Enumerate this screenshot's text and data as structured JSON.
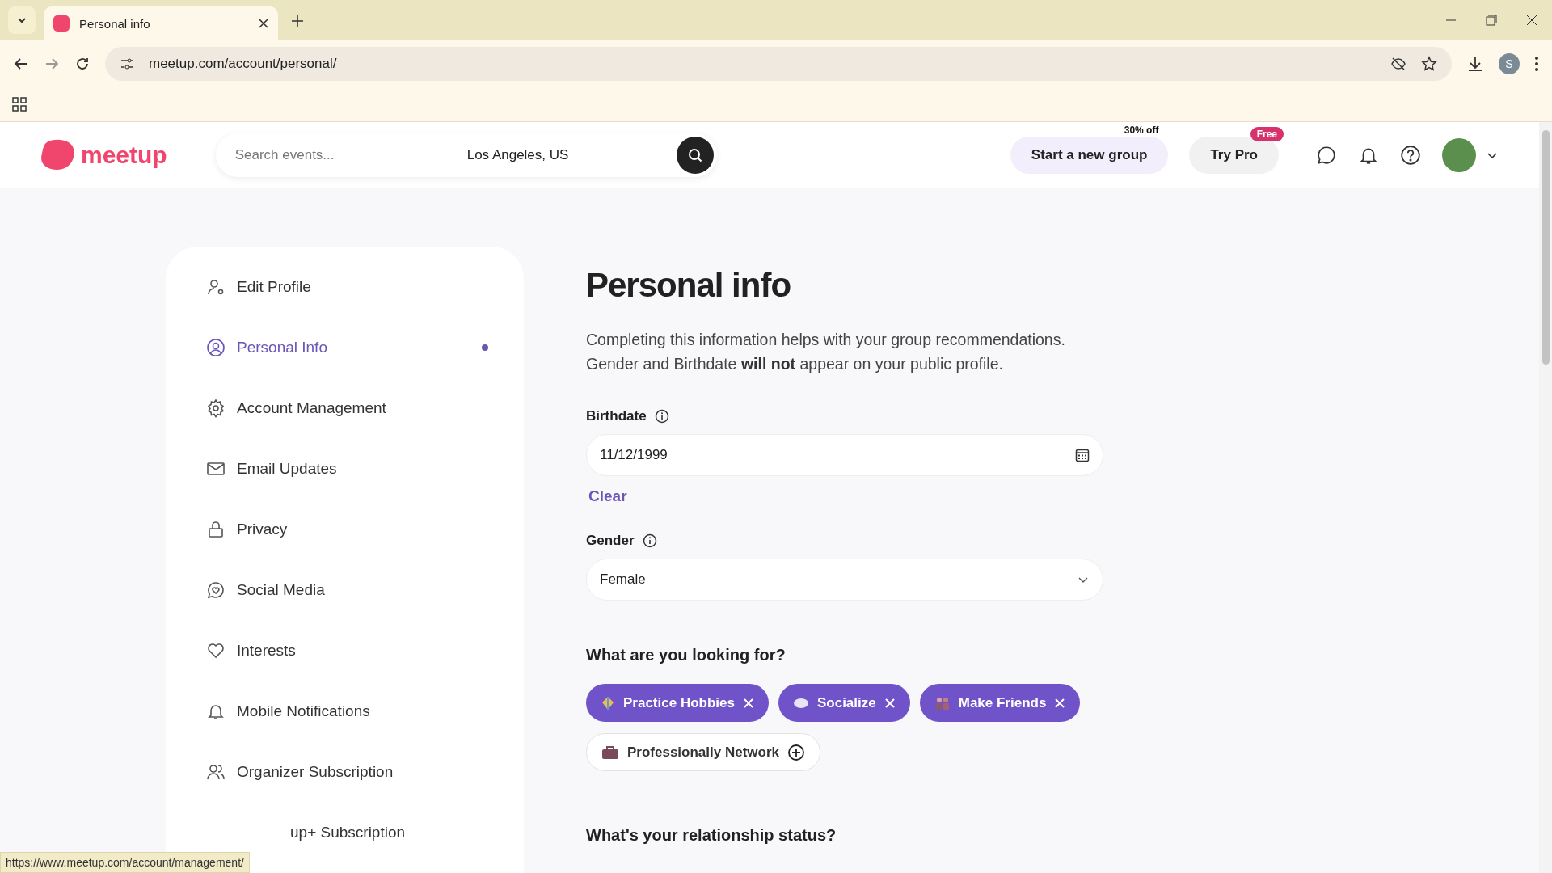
{
  "browser": {
    "tab_title": "Personal info",
    "url": "meetup.com/account/personal/",
    "profile_letter": "S",
    "status_url": "https://www.meetup.com/account/management/"
  },
  "header": {
    "logo": "meetup",
    "search_placeholder": "Search events...",
    "location": "Los Angeles, US",
    "start_group": "Start a new group",
    "start_group_badge": "30% off",
    "try_pro": "Try Pro",
    "try_pro_badge": "Free"
  },
  "sidebar": {
    "items": [
      {
        "label": "Edit Profile",
        "selected": false
      },
      {
        "label": "Personal Info",
        "selected": true
      },
      {
        "label": "Account Management",
        "selected": false
      },
      {
        "label": "Email Updates",
        "selected": false
      },
      {
        "label": "Privacy",
        "selected": false
      },
      {
        "label": "Social Media",
        "selected": false
      },
      {
        "label": "Interests",
        "selected": false
      },
      {
        "label": "Mobile Notifications",
        "selected": false
      },
      {
        "label": "Organizer Subscription",
        "selected": false
      },
      {
        "label": "up+ Subscription",
        "selected": false
      }
    ]
  },
  "main": {
    "title": "Personal info",
    "intro": "Completing this information helps with your group recommendations. Gender and Birthdate **will not** appear on your public profile.",
    "birthdate": {
      "label": "Birthdate",
      "value": "11/12/1999",
      "clear": "Clear"
    },
    "gender": {
      "label": "Gender",
      "value": "Female"
    },
    "looking_for": {
      "title": "What are you looking for?",
      "options": [
        {
          "label": "Practice Hobbies",
          "selected": true
        },
        {
          "label": "Socialize",
          "selected": true
        },
        {
          "label": "Make Friends",
          "selected": true
        },
        {
          "label": "Professionally Network",
          "selected": false
        }
      ]
    },
    "relationship": {
      "title": "What's your relationship status?"
    }
  }
}
